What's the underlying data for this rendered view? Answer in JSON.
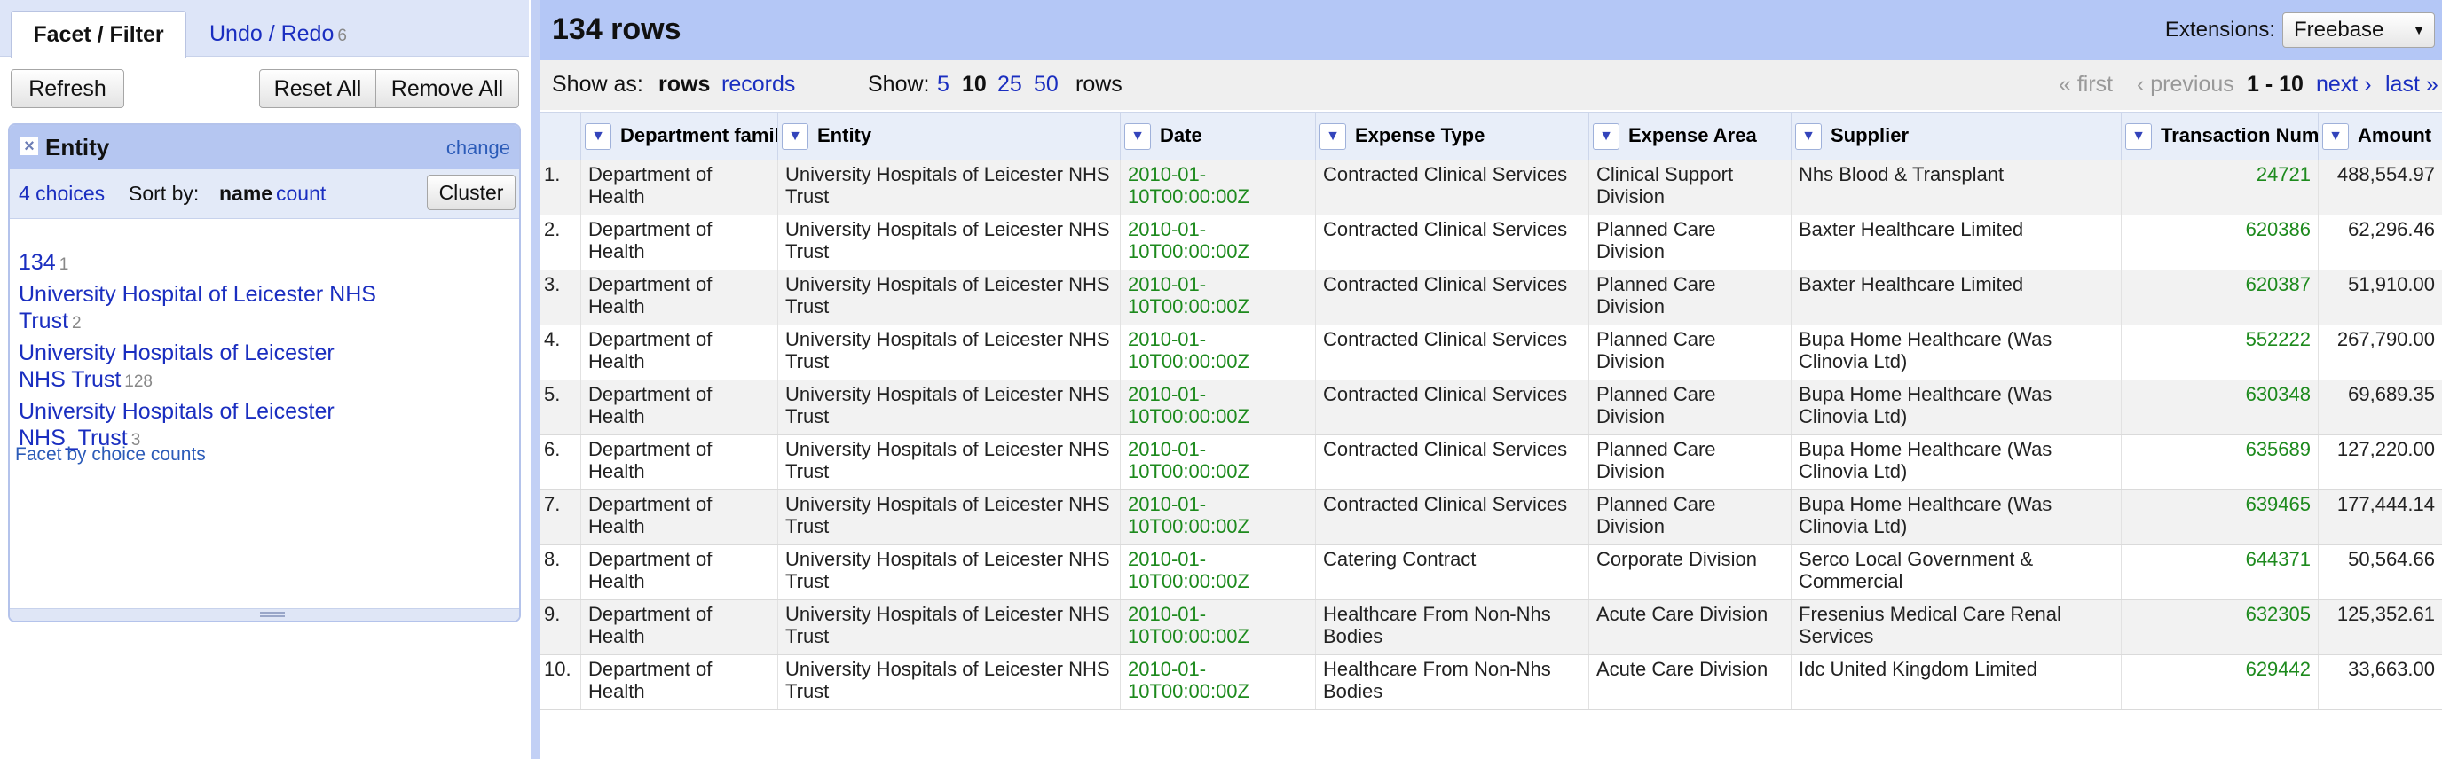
{
  "left": {
    "tabs": {
      "facet_filter": "Facet / Filter",
      "undo_redo": "Undo / Redo",
      "undo_count": "6"
    },
    "buttons": {
      "refresh": "Refresh",
      "reset_all": "Reset All",
      "remove_all": "Remove All"
    },
    "facet": {
      "title": "Entity",
      "change": "change",
      "choices_label": "4 choices",
      "sort_by": "Sort by:",
      "sort_name": "name",
      "sort_count": "count",
      "cluster": "Cluster",
      "choices": [
        {
          "label": "134",
          "count": "1"
        },
        {
          "label": "University Hospital of Leicester NHS Trust",
          "count": "2"
        },
        {
          "label": "University Hospitals of Leicester NHS Trust",
          "count": "128"
        },
        {
          "label": "University Hospitals of Leicester NHS_Trust",
          "count": "3"
        }
      ],
      "facet_by_counts": "Facet by choice counts"
    }
  },
  "right": {
    "row_count": "134 rows",
    "extensions_label": "Extensions:",
    "extensions_value": "Freebase",
    "show_as": "Show as:",
    "rows_mode": "rows",
    "records_mode": "records",
    "show": "Show:",
    "page_sizes": [
      "5",
      "10",
      "25",
      "50"
    ],
    "rows_suffix": "rows",
    "pager": {
      "first": "« first",
      "previous": "‹ previous",
      "range": "1 - 10",
      "next": "next ›",
      "last": "last »"
    },
    "columns": [
      "Department family",
      "Entity",
      "Date",
      "Expense Type",
      "Expense Area",
      "Supplier",
      "Transaction Number",
      "Amount"
    ],
    "rows": [
      {
        "n": "1.",
        "dept": "Department of Health",
        "entity": "University Hospitals of Leicester NHS Trust",
        "date": "2010-01-10T00:00:00Z",
        "type": "Contracted Clinical Services",
        "area": "Clinical Support Division",
        "supplier": "Nhs Blood & Transplant",
        "txn": "24721",
        "amount": "488,554.97"
      },
      {
        "n": "2.",
        "dept": "Department of Health",
        "entity": "University Hospitals of Leicester NHS Trust",
        "date": "2010-01-10T00:00:00Z",
        "type": "Contracted Clinical Services",
        "area": "Planned Care Division",
        "supplier": "Baxter Healthcare Limited",
        "txn": "620386",
        "amount": "62,296.46"
      },
      {
        "n": "3.",
        "dept": "Department of Health",
        "entity": "University Hospitals of Leicester NHS Trust",
        "date": "2010-01-10T00:00:00Z",
        "type": "Contracted Clinical Services",
        "area": "Planned Care Division",
        "supplier": "Baxter Healthcare Limited",
        "txn": "620387",
        "amount": "51,910.00"
      },
      {
        "n": "4.",
        "dept": "Department of Health",
        "entity": "University Hospitals of Leicester NHS Trust",
        "date": "2010-01-10T00:00:00Z",
        "type": "Contracted Clinical Services",
        "area": "Planned Care Division",
        "supplier": "Bupa Home Healthcare (Was Clinovia Ltd)",
        "txn": "552222",
        "amount": "267,790.00"
      },
      {
        "n": "5.",
        "dept": "Department of Health",
        "entity": "University Hospitals of Leicester NHS Trust",
        "date": "2010-01-10T00:00:00Z",
        "type": "Contracted Clinical Services",
        "area": "Planned Care Division",
        "supplier": "Bupa Home Healthcare (Was Clinovia Ltd)",
        "txn": "630348",
        "amount": "69,689.35"
      },
      {
        "n": "6.",
        "dept": "Department of Health",
        "entity": "University Hospitals of Leicester NHS Trust",
        "date": "2010-01-10T00:00:00Z",
        "type": "Contracted Clinical Services",
        "area": "Planned Care Division",
        "supplier": "Bupa Home Healthcare (Was Clinovia Ltd)",
        "txn": "635689",
        "amount": "127,220.00"
      },
      {
        "n": "7.",
        "dept": "Department of Health",
        "entity": "University Hospitals of Leicester NHS Trust",
        "date": "2010-01-10T00:00:00Z",
        "type": "Contracted Clinical Services",
        "area": "Planned Care Division",
        "supplier": "Bupa Home Healthcare (Was Clinovia Ltd)",
        "txn": "639465",
        "amount": "177,444.14"
      },
      {
        "n": "8.",
        "dept": "Department of Health",
        "entity": "University Hospitals of Leicester NHS Trust",
        "date": "2010-01-10T00:00:00Z",
        "type": "Catering Contract",
        "area": "Corporate Division",
        "supplier": "Serco Local Government & Commercial",
        "txn": "644371",
        "amount": "50,564.66"
      },
      {
        "n": "9.",
        "dept": "Department of Health",
        "entity": "University Hospitals of Leicester NHS Trust",
        "date": "2010-01-10T00:00:00Z",
        "type": "Healthcare From Non-Nhs Bodies",
        "area": "Acute Care Division",
        "supplier": "Fresenius Medical Care Renal Services",
        "txn": "632305",
        "amount": "125,352.61"
      },
      {
        "n": "10.",
        "dept": "Department of Health",
        "entity": "University Hospitals of Leicester NHS Trust",
        "date": "2010-01-10T00:00:00Z",
        "type": "Healthcare From Non-Nhs Bodies",
        "area": "Acute Care Division",
        "supplier": "Idc United Kingdom Limited",
        "txn": "629442",
        "amount": "33,663.00"
      }
    ]
  }
}
